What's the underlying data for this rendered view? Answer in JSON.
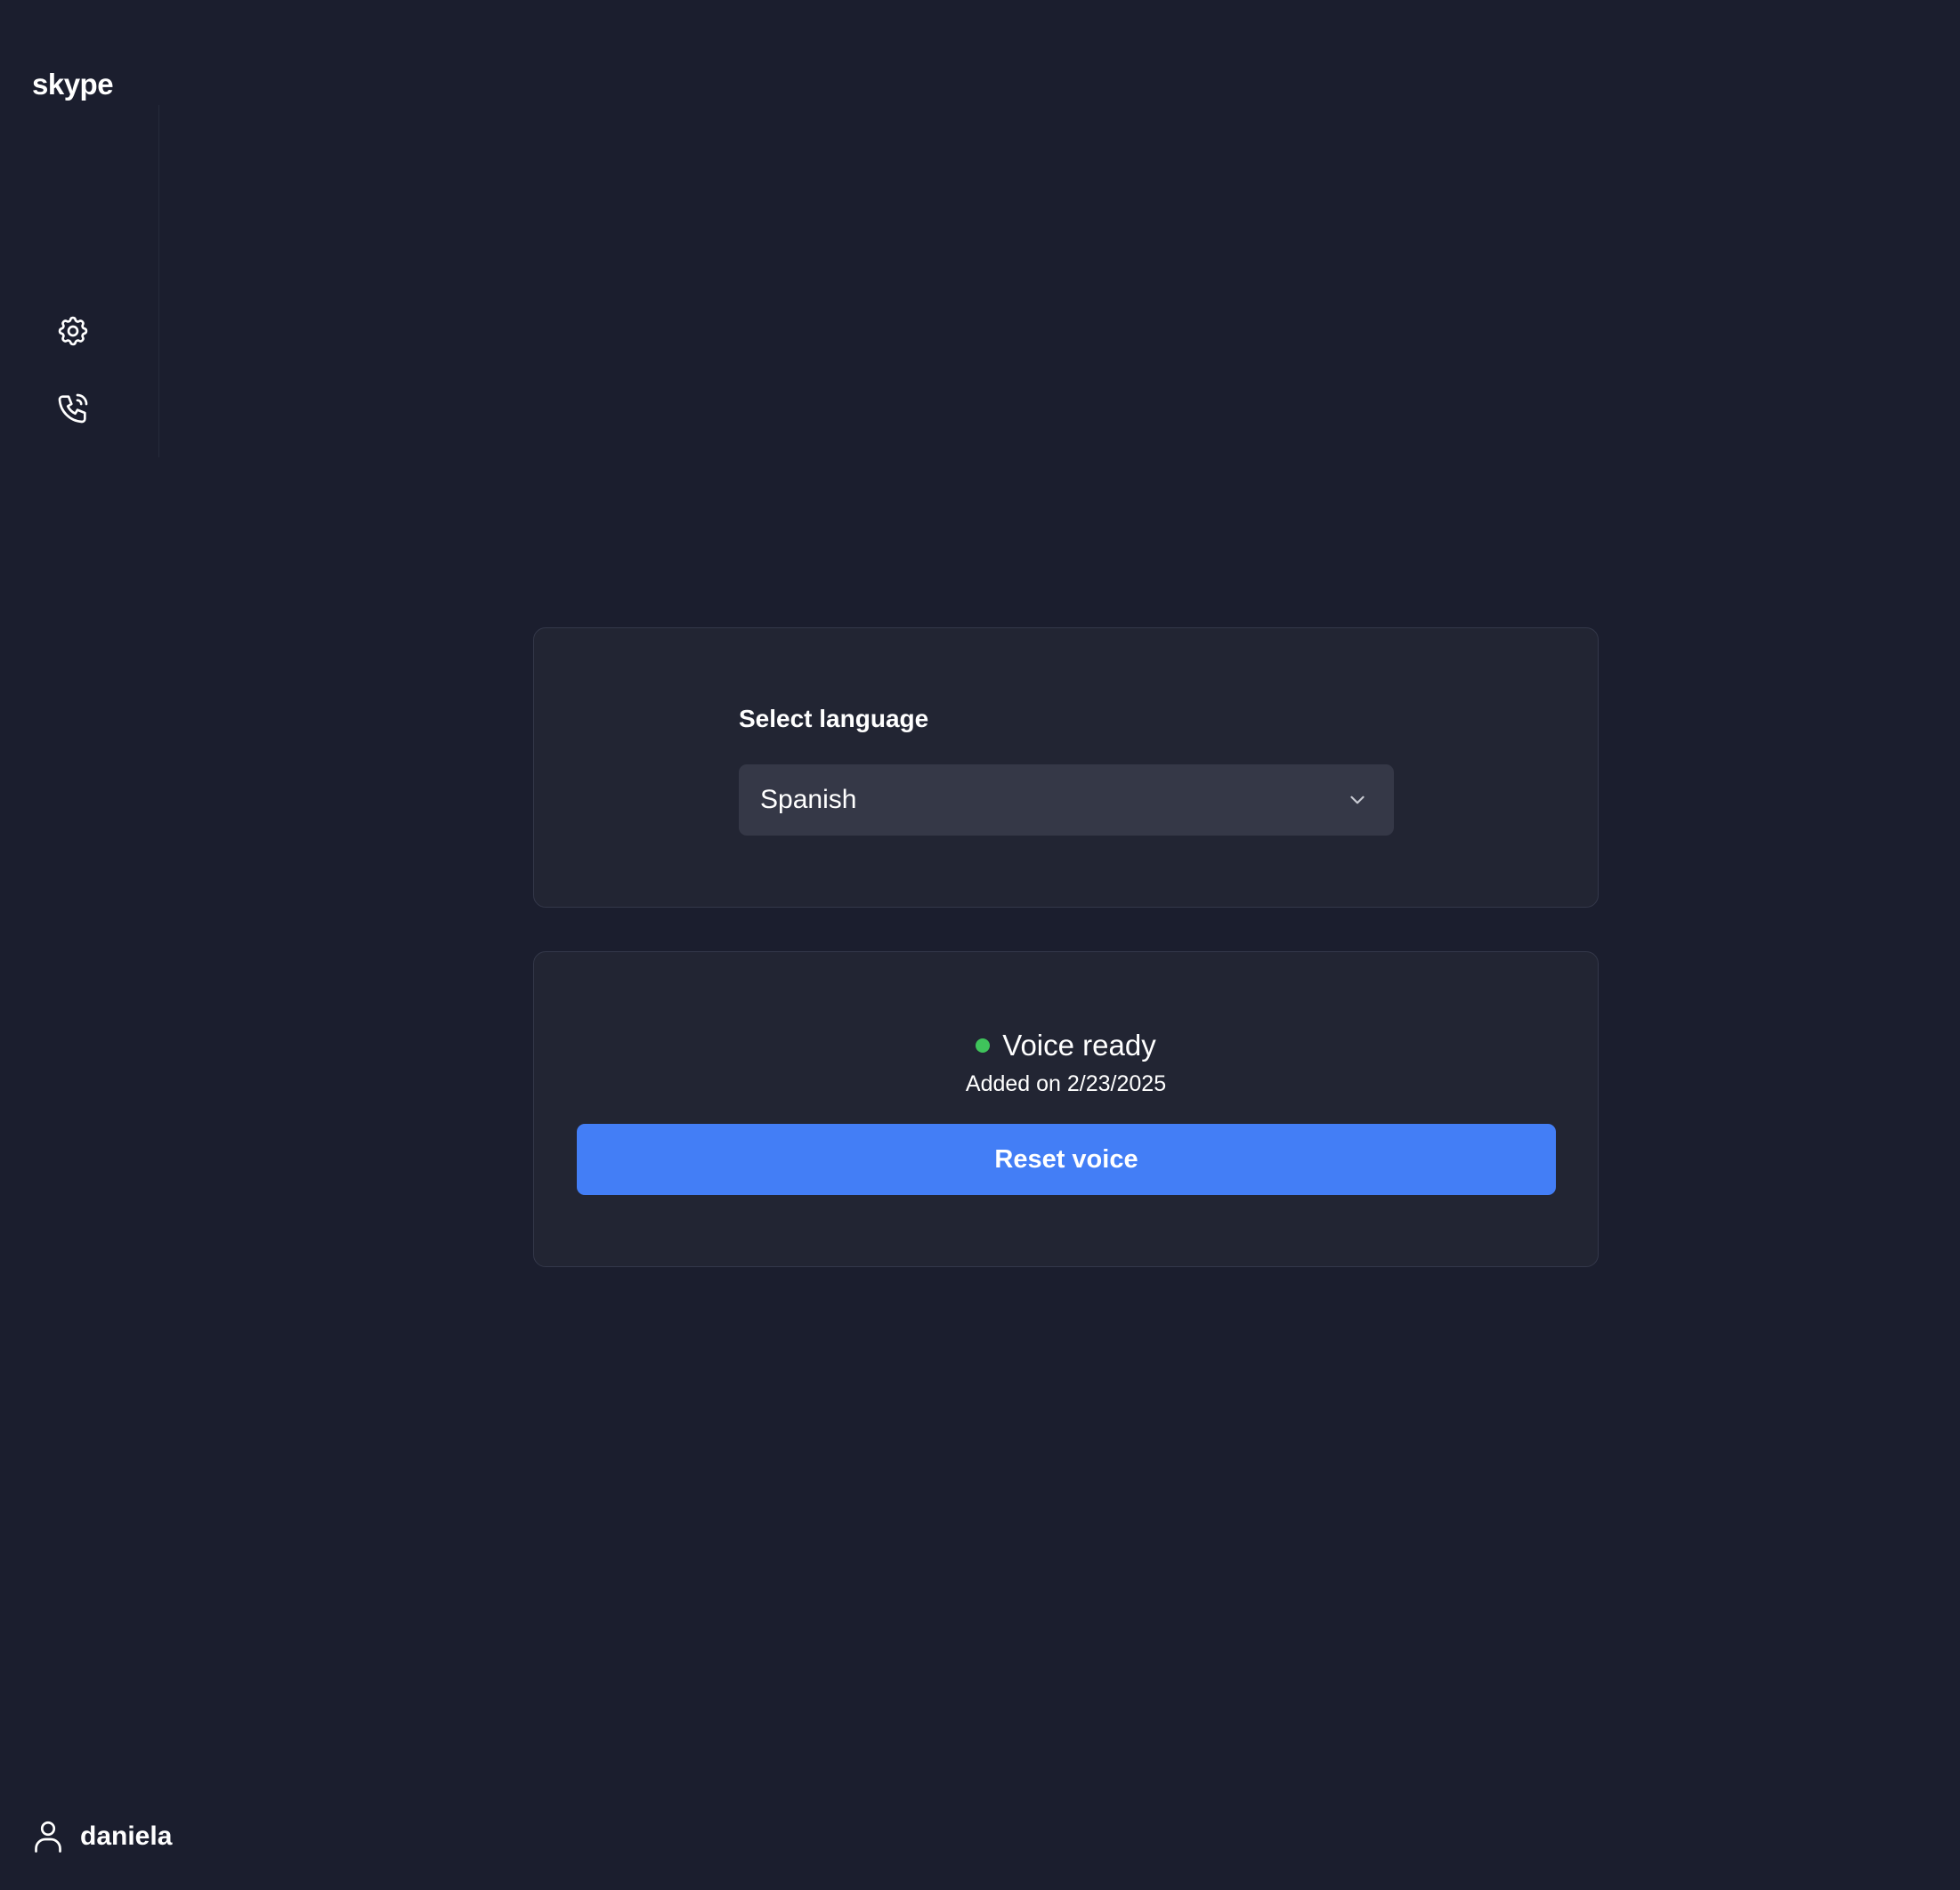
{
  "app": {
    "brand": "skype"
  },
  "sidebar": {
    "items": [
      {
        "icon": "gear-icon",
        "name": "settings"
      },
      {
        "icon": "phone-call-icon",
        "name": "calls"
      }
    ]
  },
  "language_card": {
    "label": "Select language",
    "selected": "Spanish"
  },
  "voice_card": {
    "status": "Voice ready",
    "status_color": "#3fc35b",
    "added": "Added on 2/23/2025",
    "reset_label": "Reset voice",
    "button_color": "#437ef6"
  },
  "user": {
    "name": "daniela"
  }
}
